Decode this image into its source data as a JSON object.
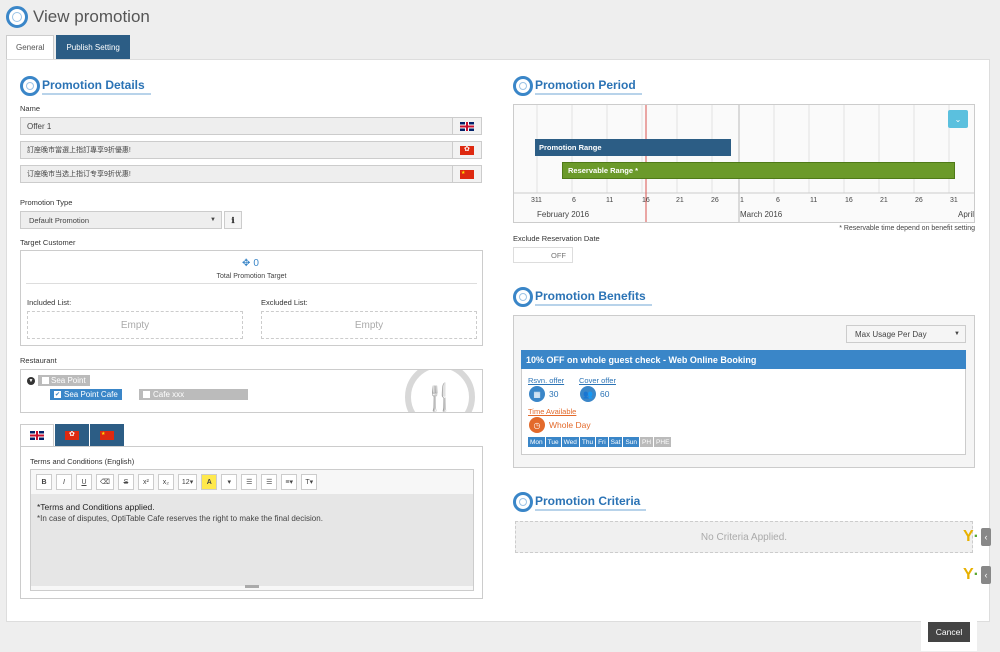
{
  "page": {
    "title": "View promotion"
  },
  "tabs": [
    {
      "label": "General",
      "active": true
    },
    {
      "label": "Publish Setting",
      "active": false
    }
  ],
  "details": {
    "title": "Promotion Details",
    "name_label": "Name",
    "name_values": [
      "Offer 1",
      "訂座晚市當選上指訂專享9折優惠!",
      "订座晚市当选上指订专享9折优惠!"
    ],
    "type_label": "Promotion Type",
    "type_value": "Default Promotion",
    "target_label": "Target Customer",
    "target_count": "0",
    "target_caption": "Total Promotion Target",
    "included_label": "Included List:",
    "excluded_label": "Excluded List:",
    "empty_text": "Empty",
    "restaurant_label": "Restaurant",
    "restaurants": {
      "group": "Sea Point",
      "selected": "Sea Point Cafe",
      "other": "Cafe xxx"
    },
    "terms_label": "Terms and Conditions (English)",
    "terms_line1": "*Terms and Conditions applied.",
    "terms_line2": "*In case of disputes, OptiTable Cafe reserves the right to make the final decision.",
    "toolbar": [
      "B",
      "I",
      "U",
      "⌫",
      "S",
      "x²",
      "x₂",
      "12▾",
      "A",
      "▾",
      "☰",
      "☰",
      "≡▾",
      "T▾"
    ]
  },
  "period": {
    "title": "Promotion Period",
    "promotion_range": "Promotion Range",
    "reservable_range": "Reservable Range *",
    "ticks": [
      "31",
      "1",
      "6",
      "11",
      "16",
      "21",
      "26",
      "31",
      "1",
      "6",
      "11",
      "16",
      "21",
      "26",
      "31"
    ],
    "months": [
      "February 2016",
      "March 2016",
      "April"
    ],
    "note": "* Reservable time depend on benefit setting",
    "exclude_label": "Exclude Reservation Date",
    "toggle_text": "OFF"
  },
  "benefits": {
    "title": "Promotion Benefits",
    "select_value": "Max Usage Per Day",
    "headline": "10% OFF on whole guest check - Web Online Booking",
    "rsvn_label": "Rsvn. offer",
    "rsvn_value": "30",
    "cover_label": "Cover offer",
    "cover_value": "60",
    "time_label": "Time Available",
    "time_value": "Whole Day",
    "days": [
      "Mon",
      "Tue",
      "Wed",
      "Thu",
      "Fri",
      "Sat",
      "Sun",
      "PH",
      "PHE"
    ]
  },
  "criteria": {
    "title": "Promotion Criteria",
    "empty_text": "No Criteria Applied."
  },
  "footer": {
    "cancel_label": "Cancel"
  },
  "colors": {
    "accent": "#3a86c8",
    "promotion_bar": "#2c5d85",
    "reservable_bar": "#6b9a2a",
    "today_line": "#d9534f"
  }
}
